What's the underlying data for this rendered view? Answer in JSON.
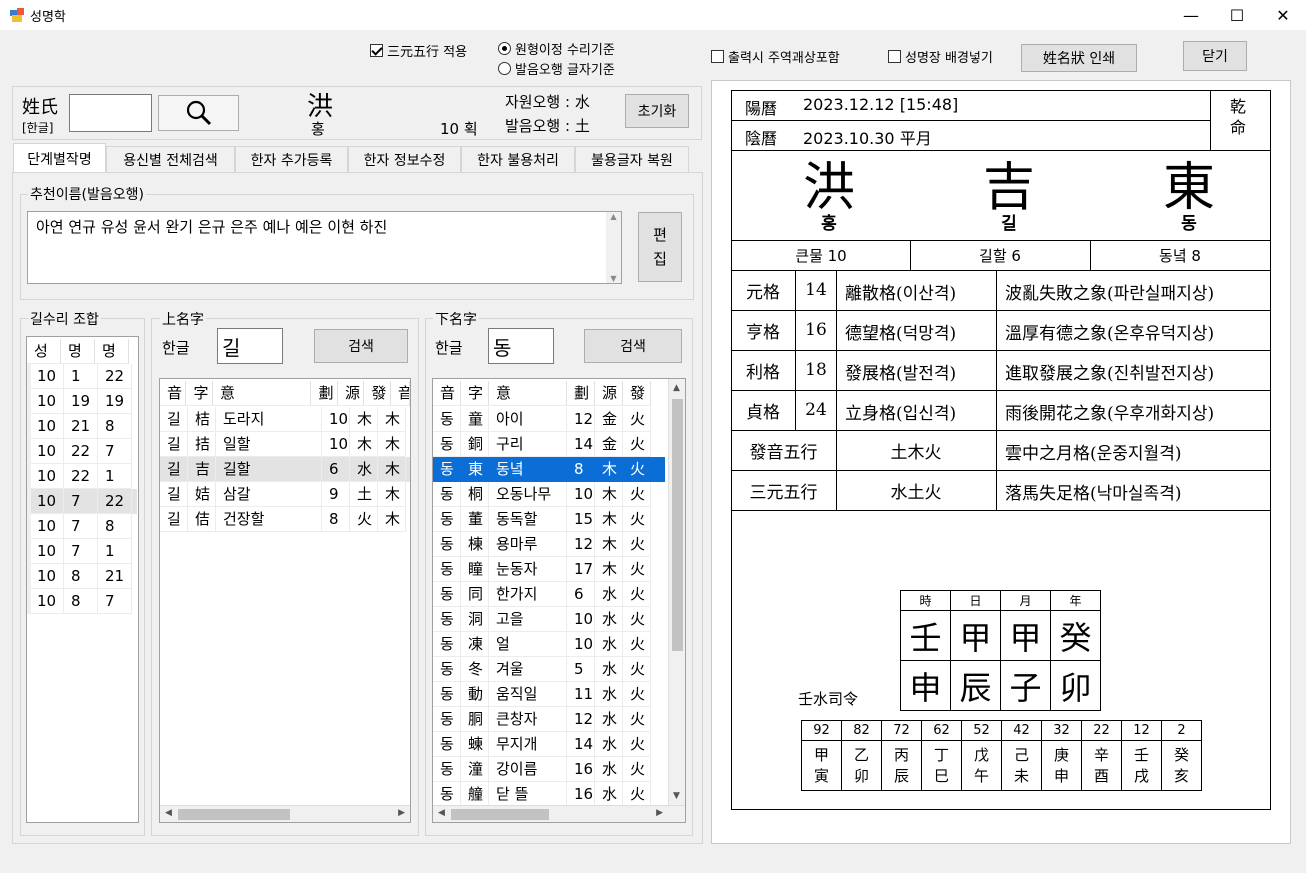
{
  "window": {
    "title": "성명학",
    "minimize": "—",
    "maximize": "☐",
    "close": "✕"
  },
  "options": {
    "samwon": {
      "label": "三元五行 적용",
      "checked": true
    },
    "radio1": {
      "label": "원형이정 수리기준",
      "selected": true
    },
    "radio2": {
      "label": "발음오행 글자기준",
      "selected": false
    },
    "juyeok": {
      "label": "출력시 주역괘상포함",
      "checked": false
    },
    "background": {
      "label": "성명장 배경넣기",
      "checked": false
    },
    "print_button": "姓名狀 인쇄",
    "close_button": "닫기"
  },
  "surname": {
    "label_top": "姓氏",
    "label_bottom": "[한글]",
    "input_value": "",
    "hanja": "洪",
    "hangul": "홍",
    "strokes": "10 획",
    "jawon_label": "자원오행 :",
    "jawon_value": "水",
    "bareum_label": "발음오행 :",
    "bareum_value": "土",
    "reset_button": "초기화"
  },
  "tabs": [
    "단계별작명",
    "용신별 전체검색",
    "한자 추가등록",
    "한자 정보수정",
    "한자 불용처리",
    "불용글자 복원"
  ],
  "recommend": {
    "title": "추천이름(발음오행)",
    "text": "아연 연규 유성 윤서 완기 은규 은주 예나 예은 이현 하진",
    "edit_button": "편\n집"
  },
  "gilsuri": {
    "title": "길수리 조합",
    "headers": [
      "성",
      "명",
      "명"
    ],
    "rows": [
      [
        "10",
        "1",
        "22"
      ],
      [
        "10",
        "19",
        "19"
      ],
      [
        "10",
        "21",
        "8"
      ],
      [
        "10",
        "22",
        "7"
      ],
      [
        "10",
        "22",
        "1"
      ],
      [
        "10",
        "7",
        "22"
      ],
      [
        "10",
        "7",
        "8"
      ],
      [
        "10",
        "7",
        "1"
      ],
      [
        "10",
        "8",
        "21"
      ],
      [
        "10",
        "8",
        "7"
      ]
    ]
  },
  "upper": {
    "title": "上名字",
    "label": "한글",
    "value": "길",
    "search_button": "검색",
    "headers": [
      "音",
      "字",
      "意",
      "劃",
      "源",
      "發",
      "音"
    ],
    "rows": [
      [
        "길",
        "桔",
        "도라지",
        "10",
        "木",
        "木"
      ],
      [
        "길",
        "拮",
        "일할",
        "10",
        "木",
        "木"
      ],
      [
        "길",
        "吉",
        "길할",
        "6",
        "水",
        "木"
      ],
      [
        "길",
        "姞",
        "삼갈",
        "9",
        "土",
        "木"
      ],
      [
        "길",
        "佶",
        "건장할",
        "8",
        "火",
        "木"
      ]
    ]
  },
  "lower": {
    "title": "下名字",
    "label": "한글",
    "value": "동",
    "search_button": "검색",
    "headers": [
      "音",
      "字",
      "意",
      "劃",
      "源",
      "發"
    ],
    "rows": [
      [
        "동",
        "童",
        "아이",
        "12",
        "金",
        "火"
      ],
      [
        "동",
        "銅",
        "구리",
        "14",
        "金",
        "火"
      ],
      [
        "동",
        "東",
        "동녘",
        "8",
        "木",
        "火"
      ],
      [
        "동",
        "桐",
        "오동나무",
        "10",
        "木",
        "火"
      ],
      [
        "동",
        "董",
        "동독할",
        "15",
        "木",
        "火"
      ],
      [
        "동",
        "棟",
        "용마루",
        "12",
        "木",
        "火"
      ],
      [
        "동",
        "瞳",
        "눈동자",
        "17",
        "木",
        "火"
      ],
      [
        "동",
        "同",
        "한가지",
        "6",
        "水",
        "火"
      ],
      [
        "동",
        "洞",
        "고을",
        "10",
        "水",
        "火"
      ],
      [
        "동",
        "凍",
        "얼",
        "10",
        "水",
        "火"
      ],
      [
        "동",
        "冬",
        "겨울",
        "5",
        "水",
        "火"
      ],
      [
        "동",
        "動",
        "움직일",
        "11",
        "水",
        "火"
      ],
      [
        "동",
        "胴",
        "큰창자",
        "12",
        "水",
        "火"
      ],
      [
        "동",
        "蝀",
        "무지개",
        "14",
        "水",
        "火"
      ],
      [
        "동",
        "潼",
        "강이름",
        "16",
        "水",
        "火"
      ],
      [
        "동",
        "艟",
        "닫 뜰",
        "16",
        "水",
        "火"
      ]
    ]
  },
  "report": {
    "yang_label": "陽曆",
    "yang_value": "2023.12.12 [15:48]",
    "eum_label": "陰曆",
    "eum_value": "2023.10.30 平月",
    "gender": "乾\n命",
    "name_hanja": [
      "洪",
      "吉",
      "東"
    ],
    "name_hangul": [
      "홍",
      "길",
      "동"
    ],
    "meanings": [
      "큰물 10",
      "길할 6",
      "동녘 8"
    ],
    "geok": [
      {
        "name": "元格",
        "num": "14",
        "geok": "離散格(이산격)",
        "sang": "波亂失敗之象(파란실패지상)"
      },
      {
        "name": "亨格",
        "num": "16",
        "geok": "德望格(덕망격)",
        "sang": "溫厚有德之象(온후유덕지상)"
      },
      {
        "name": "利格",
        "num": "18",
        "geok": "發展格(발전격)",
        "sang": "進取發展之象(진취발전지상)"
      },
      {
        "name": "貞格",
        "num": "24",
        "geok": "立身格(입신격)",
        "sang": "雨後開花之象(우후개화지상)"
      }
    ],
    "ohaeng": [
      {
        "name": "發音五行",
        "value": "土木火",
        "desc": "雲中之月格(운중지월격)"
      },
      {
        "name": "三元五行",
        "value": "水土火",
        "desc": "落馬失足格(낙마실족격)"
      }
    ],
    "saju_headers": [
      "時",
      "日",
      "月",
      "年"
    ],
    "saju_top": [
      "壬",
      "甲",
      "甲",
      "癸"
    ],
    "saju_bottom": [
      "申",
      "辰",
      "子",
      "卯"
    ],
    "saryeong": "壬水司令",
    "daewoon_ages": [
      "92",
      "82",
      "72",
      "62",
      "52",
      "42",
      "32",
      "22",
      "12",
      "2"
    ],
    "daewoon_top": [
      "甲",
      "乙",
      "丙",
      "丁",
      "戊",
      "己",
      "庚",
      "辛",
      "壬",
      "癸"
    ],
    "daewoon_bottom": [
      "寅",
      "卯",
      "辰",
      "巳",
      "午",
      "未",
      "申",
      "酉",
      "戌",
      "亥"
    ]
  }
}
